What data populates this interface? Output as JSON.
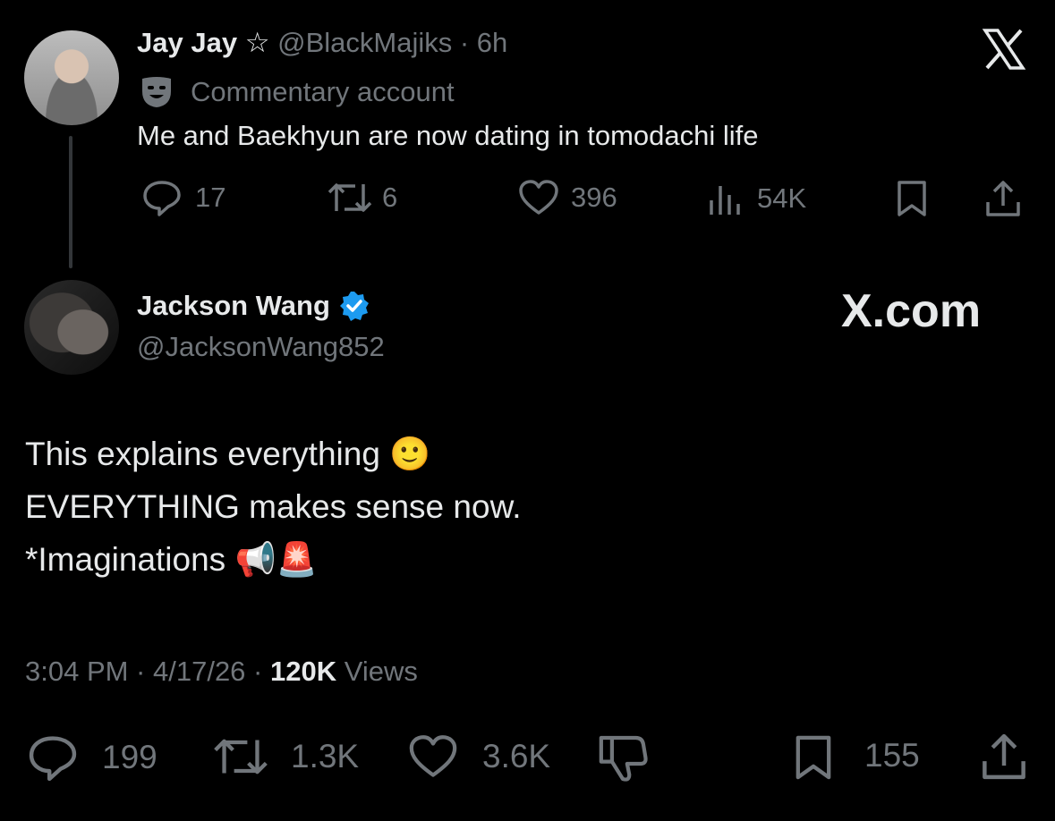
{
  "parent_tweet": {
    "display_name": "Jay Jay",
    "name_badge": "☆",
    "handle": "@BlackMajiks",
    "time": "· 6h",
    "label": "Commentary account",
    "text": "Me and Baekhyun are now dating in tomodachi life",
    "replies": "17",
    "reposts": "6",
    "likes": "396",
    "views": "54K"
  },
  "main_tweet": {
    "display_name": "Jackson Wang",
    "handle": "@JacksonWang852",
    "line1": "This explains everything 🙂",
    "line2": "EVERYTHING makes sense now.",
    "line3": "*Imaginations 📢🚨",
    "timestamp": "3:04 PM · 4/17/26 · ",
    "views_count": "120K",
    "views_label": " Views",
    "replies": "199",
    "reposts": "1.3K",
    "likes": "3.6K",
    "bookmarks": "155"
  },
  "watermark": "X.com",
  "colors": {
    "background": "#000000",
    "text": "#e7e9ea",
    "muted": "#71767b",
    "verified": "#1d9bf0"
  },
  "icons": [
    "x-logo-icon",
    "commentary-mask-icon",
    "reply-icon",
    "repost-icon",
    "like-icon",
    "views-icon",
    "bookmark-icon",
    "share-icon",
    "verified-badge-icon",
    "dislike-icon"
  ]
}
